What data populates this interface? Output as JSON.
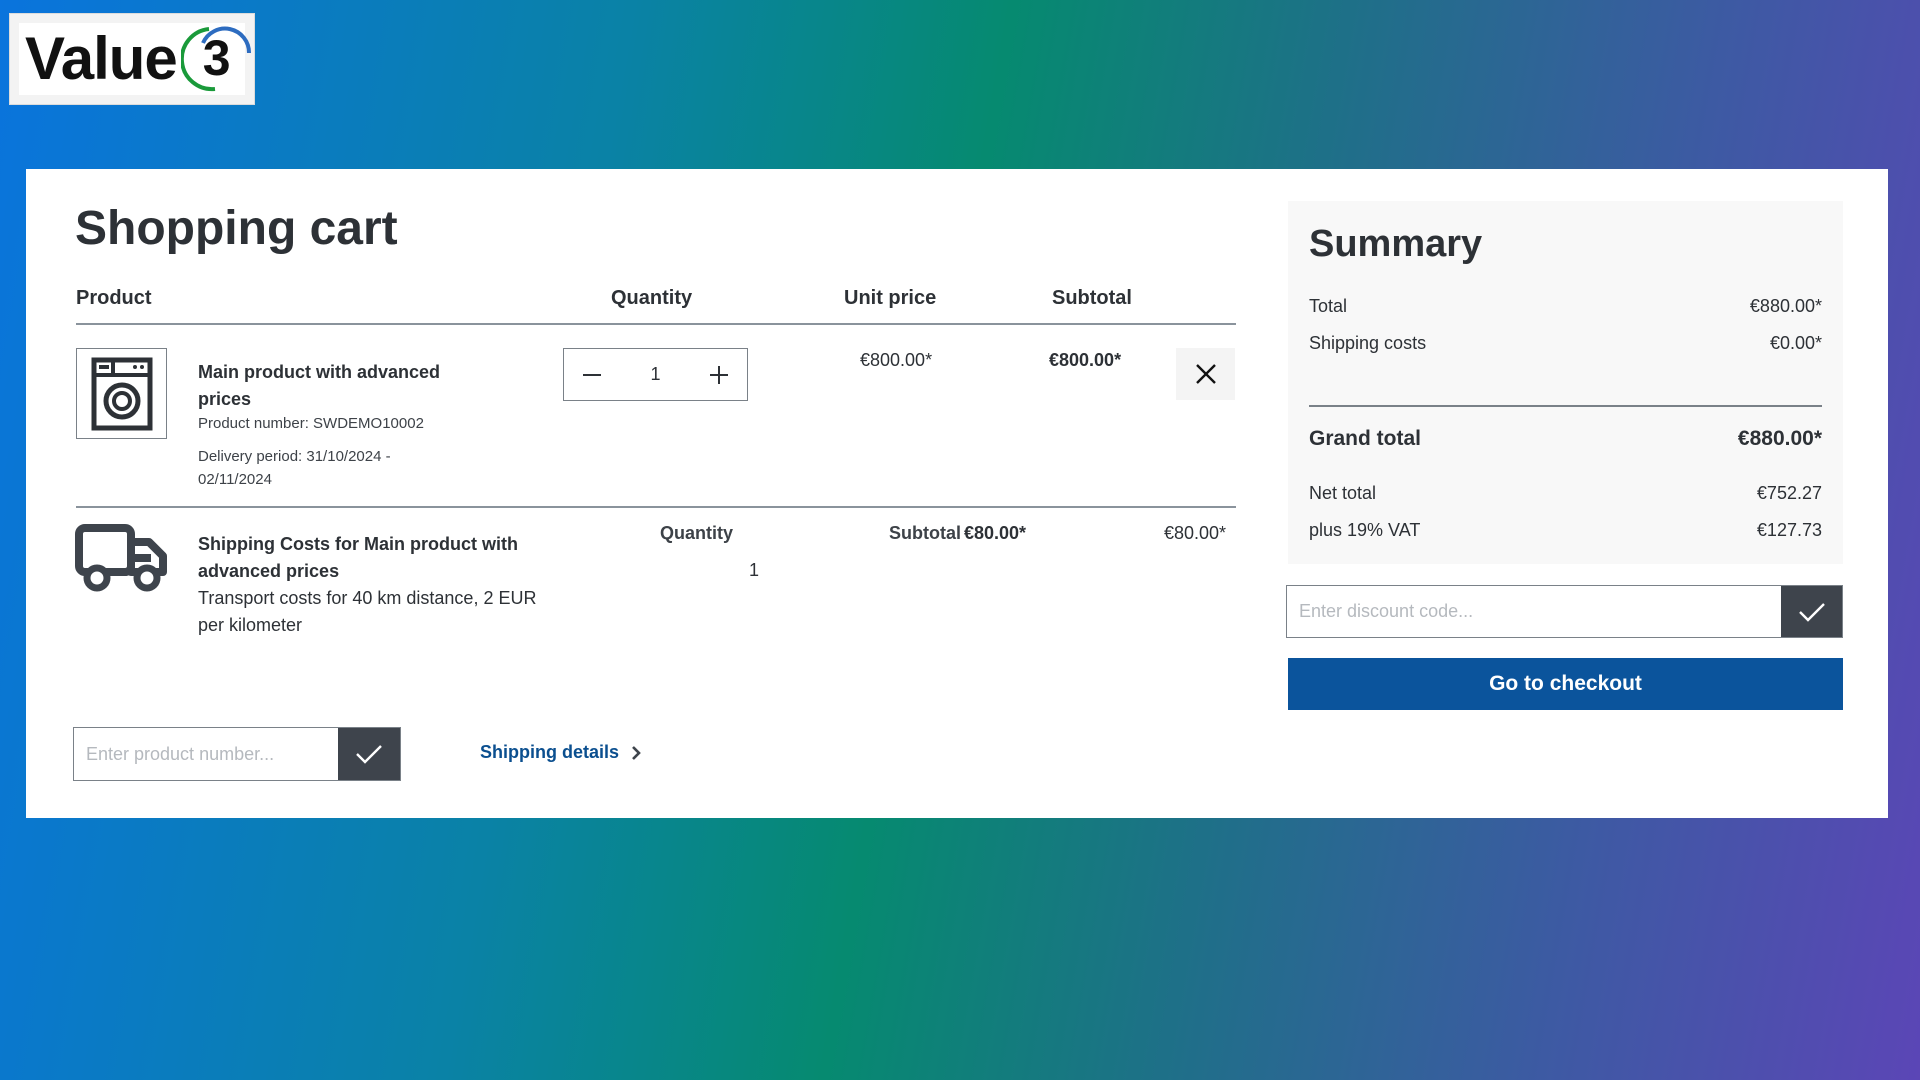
{
  "brand": {
    "logo_text": "Value",
    "logo_mark": "3",
    "colors": {
      "arc_green": "#1a9a3a",
      "arc_blue": "#2d6cc0"
    }
  },
  "cart": {
    "title": "Shopping cart",
    "columns": {
      "product": "Product",
      "quantity": "Quantity",
      "unit_price": "Unit price",
      "subtotal": "Subtotal"
    },
    "items": [
      {
        "icon": "washing-machine-icon",
        "name": "Main product with advanced prices",
        "product_number": "Product number: SWDEMO10002",
        "delivery_line1": "Delivery period: 31/10/2024 -",
        "delivery_line2": "02/11/2024",
        "quantity": "1",
        "unit_price": "€800.00*",
        "subtotal": "€800.00*"
      }
    ],
    "shipping_item": {
      "icon": "truck-icon",
      "name": "Shipping Costs for Main product with advanced prices",
      "description": "Transport costs for 40 km distance, 2 EUR per kilometer",
      "quantity_label": "Quantity",
      "quantity": "1",
      "subtotal_label": "Subtotal",
      "subtotal": "€80.00*",
      "price": "€80.00*"
    },
    "product_number_input": {
      "placeholder": "Enter product number...",
      "value": ""
    },
    "shipping_details_link": "Shipping details"
  },
  "summary": {
    "title": "Summary",
    "total_label": "Total",
    "total": "€880.00*",
    "shipping_label": "Shipping costs",
    "shipping": "€0.00*",
    "grand_total_label": "Grand total",
    "grand_total": "€880.00*",
    "net_total_label": "Net total",
    "net_total": "€752.27",
    "vat_label": "plus 19% VAT",
    "vat": "€127.73"
  },
  "discount_input": {
    "placeholder": "Enter discount code...",
    "value": ""
  },
  "checkout_button": "Go to checkout",
  "colors": {
    "primary": "#0b549c",
    "link": "#0b4f8f",
    "dark_button": "#3e444c",
    "text": "#2d3136"
  }
}
